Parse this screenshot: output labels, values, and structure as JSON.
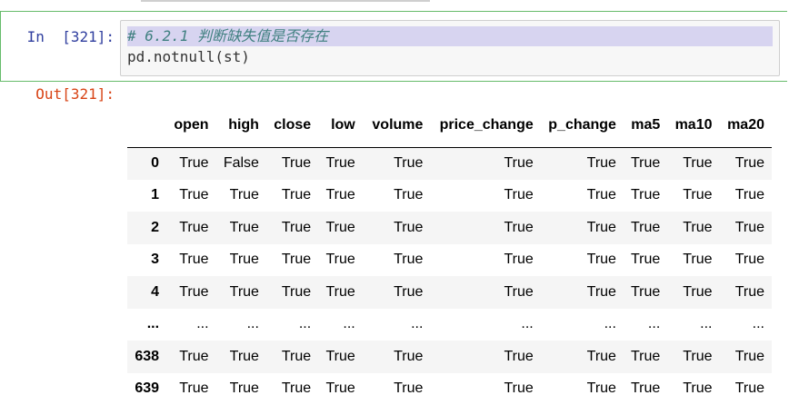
{
  "input_cell": {
    "prompt": "In  [321]:",
    "code_lines": [
      "# 6.2.1 判断缺失值是否存在",
      "pd.notnull(st)"
    ]
  },
  "output_cell": {
    "prompt": "Out[321]:",
    "columns": [
      "",
      "open",
      "high",
      "close",
      "low",
      "volume",
      "price_change",
      "p_change",
      "ma5",
      "ma10",
      "ma20"
    ],
    "rows": [
      {
        "index": "0",
        "values": [
          "True",
          "False",
          "True",
          "True",
          "True",
          "True",
          "True",
          "True",
          "True",
          "True"
        ]
      },
      {
        "index": "1",
        "values": [
          "True",
          "True",
          "True",
          "True",
          "True",
          "True",
          "True",
          "True",
          "True",
          "True"
        ]
      },
      {
        "index": "2",
        "values": [
          "True",
          "True",
          "True",
          "True",
          "True",
          "True",
          "True",
          "True",
          "True",
          "True"
        ]
      },
      {
        "index": "3",
        "values": [
          "True",
          "True",
          "True",
          "True",
          "True",
          "True",
          "True",
          "True",
          "True",
          "True"
        ]
      },
      {
        "index": "4",
        "values": [
          "True",
          "True",
          "True",
          "True",
          "True",
          "True",
          "True",
          "True",
          "True",
          "True"
        ]
      },
      {
        "index": "...",
        "values": [
          "...",
          "...",
          "...",
          "...",
          "...",
          "...",
          "...",
          "...",
          "...",
          "..."
        ]
      },
      {
        "index": "638",
        "values": [
          "True",
          "True",
          "True",
          "True",
          "True",
          "True",
          "True",
          "True",
          "True",
          "True"
        ]
      },
      {
        "index": "639",
        "values": [
          "True",
          "True",
          "True",
          "True",
          "True",
          "True",
          "True",
          "True",
          "True",
          "True"
        ]
      }
    ]
  }
}
